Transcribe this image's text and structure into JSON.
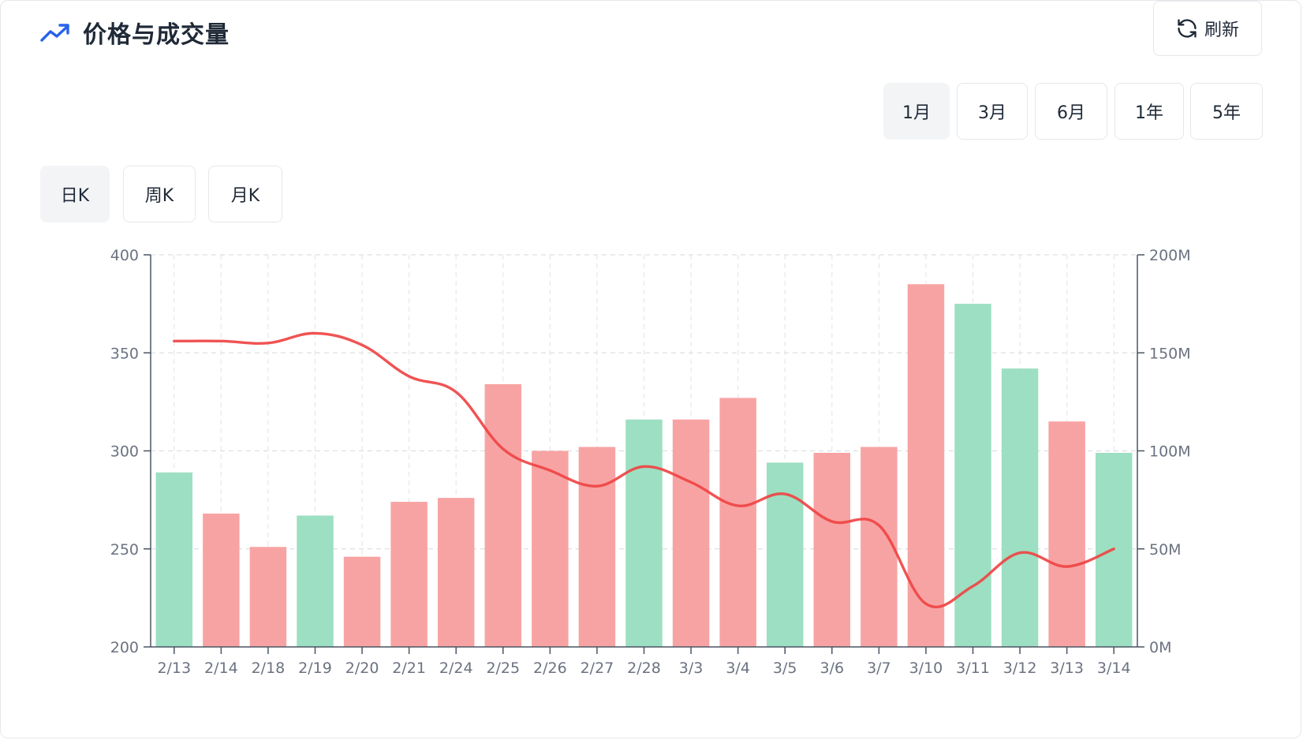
{
  "header": {
    "title": "价格与成交量",
    "refresh_label": "刷新"
  },
  "range_tabs": [
    {
      "label": "1月",
      "active": true
    },
    {
      "label": "3月",
      "active": false
    },
    {
      "label": "6月",
      "active": false
    },
    {
      "label": "1年",
      "active": false
    },
    {
      "label": "5年",
      "active": false
    }
  ],
  "period_tabs": [
    {
      "label": "日K",
      "active": true
    },
    {
      "label": "周K",
      "active": false
    },
    {
      "label": "月K",
      "active": false
    }
  ],
  "colors": {
    "accent": "#2563eb",
    "up_bar": "#f8a3a3",
    "down_bar": "#9ddfc2",
    "price_line": "#ef4444"
  },
  "chart_data": {
    "type": "bar",
    "categories": [
      "2/13",
      "2/14",
      "2/18",
      "2/19",
      "2/20",
      "2/21",
      "2/24",
      "2/25",
      "2/26",
      "2/27",
      "2/28",
      "3/3",
      "3/4",
      "3/5",
      "3/6",
      "3/7",
      "3/10",
      "3/11",
      "3/12",
      "3/13",
      "3/14"
    ],
    "series": [
      {
        "type": "bar",
        "axis": "right",
        "values": [
          89,
          68,
          51,
          67,
          46,
          74,
          76,
          134,
          100,
          102,
          116,
          116,
          127,
          94,
          99,
          102,
          185,
          175,
          142,
          115,
          99
        ],
        "direction": [
          "down",
          "up",
          "up",
          "down",
          "up",
          "up",
          "up",
          "up",
          "up",
          "up",
          "down",
          "up",
          "up",
          "down",
          "up",
          "up",
          "up",
          "down",
          "down",
          "up",
          "down"
        ]
      },
      {
        "type": "line",
        "axis": "left",
        "values": [
          356,
          356,
          355,
          360,
          354,
          338,
          330,
          301,
          290,
          282,
          292,
          284,
          272,
          278,
          264,
          262,
          222,
          231,
          248,
          241,
          250
        ]
      }
    ],
    "y_left": {
      "ticks": [
        "200",
        "250",
        "300",
        "350",
        "400"
      ],
      "range": [
        200,
        400
      ]
    },
    "y_right": {
      "ticks": [
        "0M",
        "50M",
        "100M",
        "150M",
        "200M"
      ],
      "range": [
        0,
        200
      ]
    },
    "grid": true
  }
}
